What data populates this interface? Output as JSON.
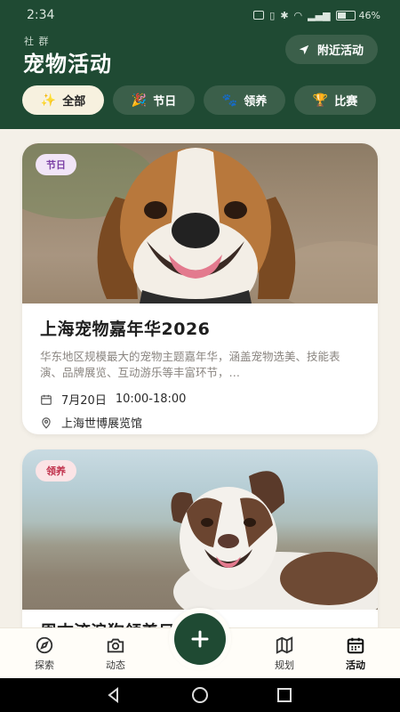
{
  "status_bar": {
    "time": "2:34",
    "battery": "46%"
  },
  "header": {
    "subtitle": "社 群",
    "title": "宠物活动",
    "nearby_label": "附近活动"
  },
  "chips": [
    {
      "icon": "✨",
      "label": "全部",
      "active": true
    },
    {
      "icon": "🎉",
      "label": "节日",
      "active": false
    },
    {
      "icon": "🐾",
      "label": "领养",
      "active": false
    },
    {
      "icon": "🏆",
      "label": "比赛",
      "active": false
    }
  ],
  "events": [
    {
      "tag": "节日",
      "title": "上海宠物嘉年华2026",
      "description": "华东地区规模最大的宠物主题嘉年华，涵盖宠物选美、技能表演、品牌展览、互动游乐等丰富环节，…",
      "date": "7月20日",
      "time": "10:00-18:00",
      "location": "上海世博展览馆",
      "image": "beagle-photo"
    },
    {
      "tag": "领养",
      "title": "周末流浪狗领养日",
      "image": "australian-shepherd-photo"
    }
  ],
  "bottom_nav": [
    {
      "label": "探索",
      "icon": "compass-icon"
    },
    {
      "label": "动态",
      "icon": "camera-icon"
    },
    {
      "label": "规划",
      "icon": "map-icon"
    },
    {
      "label": "活动",
      "icon": "calendar-icon",
      "active": true
    }
  ],
  "colors": {
    "header_bg": "#1f4a33",
    "chip_bg": "#3b5f4a",
    "chip_active_bg": "#f7f1df",
    "page_bg": "#f4f0e8",
    "fest_tag": "#7b3fa5",
    "adopt_tag": "#c0304b"
  }
}
